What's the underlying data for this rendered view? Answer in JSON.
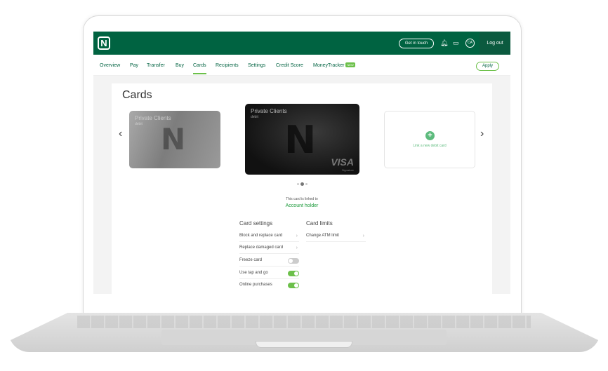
{
  "header": {
    "logo": "N",
    "get_in_touch": "Get in touch",
    "avatar": "CA",
    "logout": "Log out"
  },
  "nav": {
    "items": [
      "Overview",
      "Pay",
      "Transfer",
      "Buy",
      "Cards",
      "Recipients",
      "Settings",
      "Credit Score",
      "MoneyTracker"
    ],
    "new_badge": "NEW",
    "active": "Cards",
    "apply": "Apply"
  },
  "page": {
    "title": "Cards"
  },
  "cards": [
    {
      "name": "Private Clients",
      "type": "debit"
    },
    {
      "name": "Private Clients",
      "type": "debit",
      "network": "VISA",
      "tier": "Signature"
    }
  ],
  "add_card": "Link a new debit card",
  "linked": {
    "label": "This card is linked to",
    "holder": "Account holder"
  },
  "settings": {
    "title": "Card settings",
    "items": [
      {
        "label": "Block and replace card"
      },
      {
        "label": "Replace damaged card"
      },
      {
        "label": "Freeze card",
        "toggle": false
      },
      {
        "label": "Use tap and go",
        "toggle": true
      },
      {
        "label": "Online purchases",
        "toggle": true
      }
    ]
  },
  "limits": {
    "title": "Card limits",
    "items": [
      {
        "label": "Change ATM limit"
      }
    ]
  },
  "colors": {
    "brand": "#006341",
    "accent": "#6cc04a"
  }
}
